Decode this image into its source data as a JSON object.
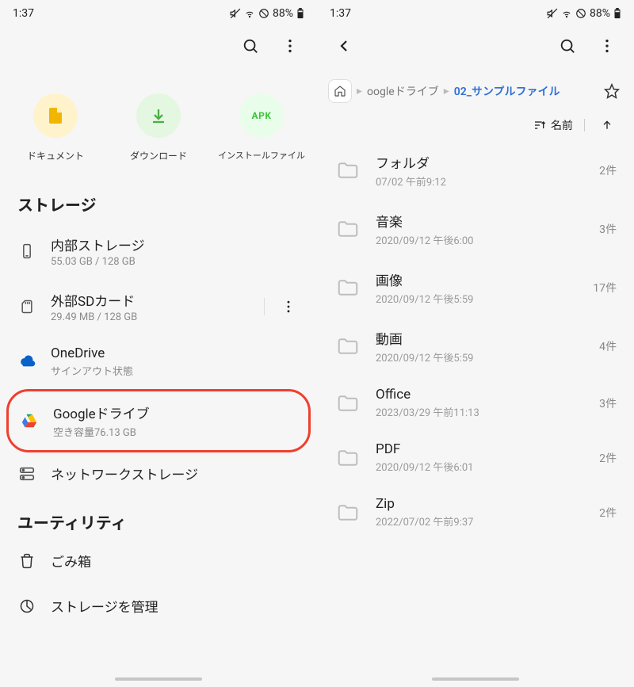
{
  "status": {
    "time": "1:37",
    "battery": "88%"
  },
  "left": {
    "categories": [
      {
        "label": "ドキュメント"
      },
      {
        "label": "ダウンロード"
      },
      {
        "label": "インストールファイル",
        "apk": "APK"
      }
    ],
    "storage_header": "ストレージ",
    "storage": {
      "internal": {
        "title": "内部ストレージ",
        "sub": "55.03 GB / 128 GB"
      },
      "sdcard": {
        "title": "外部SDカード",
        "sub": "29.49 MB / 128 GB"
      },
      "onedrive": {
        "title": "OneDrive",
        "sub": "サインアウト状態"
      },
      "gdrive": {
        "title": "Googleドライブ",
        "sub": "空き容量76.13 GB"
      },
      "network": {
        "title": "ネットワークストレージ"
      }
    },
    "utility_header": "ユーティリティ",
    "utility": {
      "trash": {
        "title": "ごみ箱"
      },
      "manage": {
        "title": "ストレージを管理"
      }
    }
  },
  "right": {
    "breadcrumb": {
      "parent": "oogleドライブ",
      "current": "02_サンプルファイル"
    },
    "sort": {
      "label": "名前"
    },
    "folders": [
      {
        "title": "フォルダ",
        "sub": "07/02 午前9:12",
        "count": "2件"
      },
      {
        "title": "音楽",
        "sub": "2020/09/12 午後6:00",
        "count": "3件"
      },
      {
        "title": "画像",
        "sub": "2020/09/12 午後5:59",
        "count": "17件"
      },
      {
        "title": "動画",
        "sub": "2020/09/12 午後5:59",
        "count": "4件"
      },
      {
        "title": "Office",
        "sub": "2023/03/29 午前11:13",
        "count": "3件"
      },
      {
        "title": "PDF",
        "sub": "2020/09/12 午後6:01",
        "count": "2件"
      },
      {
        "title": "Zip",
        "sub": "2022/07/02 午前9:37",
        "count": "2件"
      }
    ]
  }
}
